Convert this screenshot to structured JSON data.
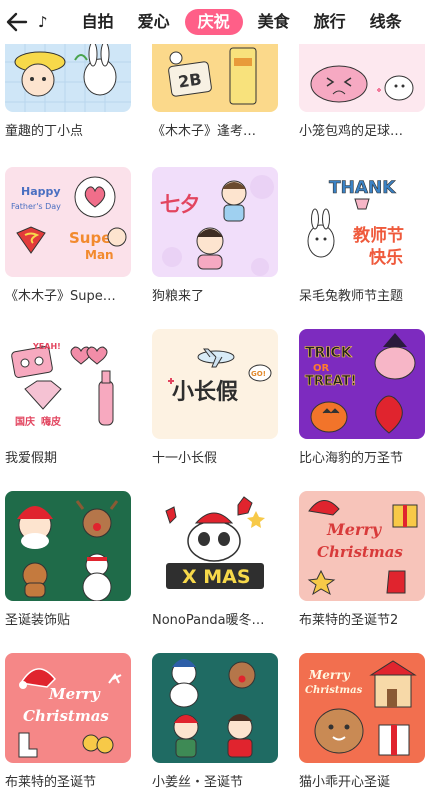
{
  "nav": {
    "back_icon": "arrow-left-icon",
    "note_icon": "music-note-icon",
    "note_glyph": "♪",
    "tabs": [
      {
        "label": "自拍",
        "active": false
      },
      {
        "label": "爱心",
        "active": false
      },
      {
        "label": "庆祝",
        "active": true
      },
      {
        "label": "美食",
        "active": false
      },
      {
        "label": "旅行",
        "active": false
      },
      {
        "label": "线条",
        "active": false
      }
    ],
    "active_color": "#ff5f88"
  },
  "stickers": [
    {
      "title": "童趣的丁小点"
    },
    {
      "title": "《木木子》逢考…"
    },
    {
      "title": "小笼包鸡的足球…"
    },
    {
      "title": "《木木子》Supe…"
    },
    {
      "title": "狗粮来了"
    },
    {
      "title": "呆毛兔教师节主题"
    },
    {
      "title": "我爱假期"
    },
    {
      "title": "十一小长假"
    },
    {
      "title": "比心海豹的万圣节"
    },
    {
      "title": "圣诞装饰贴"
    },
    {
      "title": "NonoPanda暖冬…"
    },
    {
      "title": "布莱特的圣诞节2"
    },
    {
      "title": "布莱特的圣诞节"
    },
    {
      "title": "小姜丝・圣诞节"
    },
    {
      "title": "猫小乖开心圣诞"
    }
  ],
  "thumb_text": {
    "t2": "2B",
    "t4a": "Happy",
    "t4b": "Father's Day",
    "t4c": "Super",
    "t4d": "Man",
    "t5": "七夕",
    "t6a": "THANK",
    "t6b": "教师节",
    "t6c": "快乐",
    "t7a": "YEAH!",
    "t7b": "国庆",
    "t7c": "嗨皮",
    "t8a": "小长假",
    "t8b": "GO!",
    "t9a": "TRICK",
    "t9b": "OR",
    "t9c": "TREAT!",
    "t11": "X MAS",
    "t12a": "Merry",
    "t12b": "Christmas",
    "t13a": "Merry",
    "t13b": "Christmas",
    "t15a": "Merry",
    "t15b": "Christmas"
  }
}
